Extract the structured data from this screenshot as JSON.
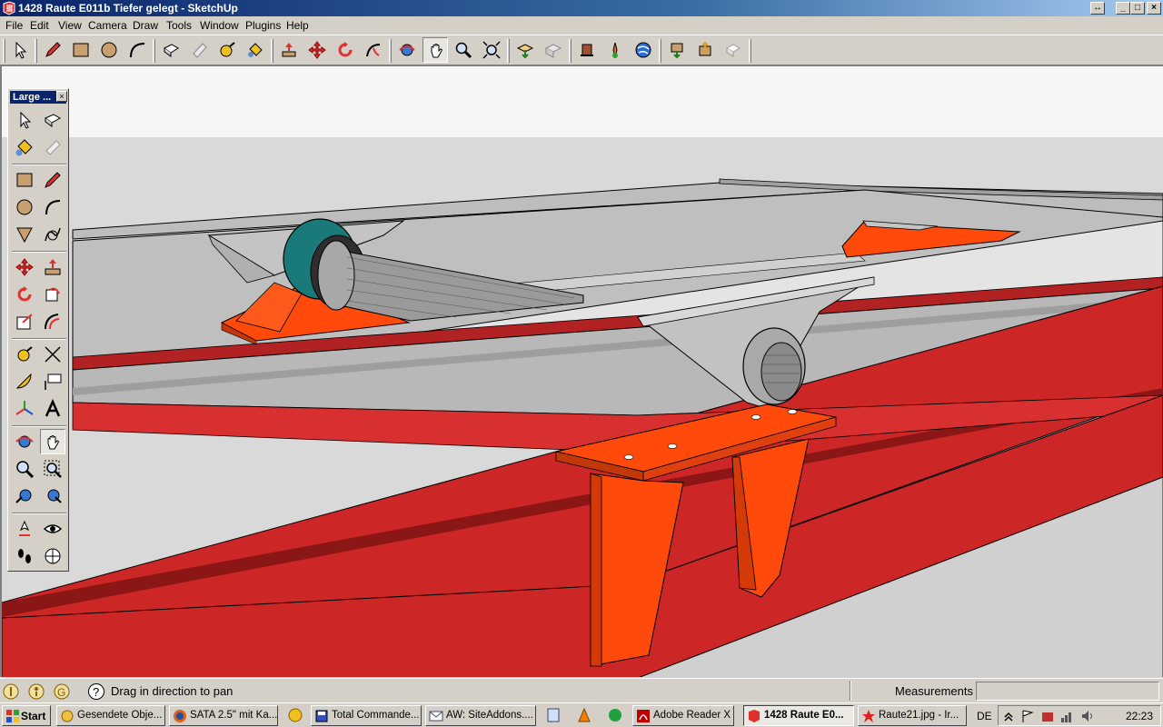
{
  "window": {
    "title": "1428 Raute E011b Tiefer gelegt - SketchUp",
    "controls": {
      "restore_alt": "↔",
      "minimize": "_",
      "maximize": "□",
      "close": "×"
    }
  },
  "menubar": [
    "File",
    "Edit",
    "View",
    "Camera",
    "Draw",
    "Tools",
    "Window",
    "Plugins",
    "Help"
  ],
  "toolbar": {
    "tools": [
      "select-icon",
      "pencil-icon",
      "rectangle-icon",
      "circle-icon",
      "arc-icon",
      "make-component-icon",
      "eraser-icon",
      "tape-measure-icon",
      "paint-bucket-icon",
      "push-pull-icon",
      "move-icon",
      "rotate-icon",
      "follow-me-icon",
      "orbit-icon",
      "pan-icon",
      "zoom-icon",
      "zoom-extents-icon",
      "get-models-icon",
      "share-model-icon",
      "components-icon",
      "add-location-icon",
      "google-earth-icon",
      "get-components-icon",
      "share-component-icon",
      "section-icon"
    ],
    "active": "pan-icon"
  },
  "palette": {
    "title": "Large ...",
    "close": "×",
    "active": "pan-icon"
  },
  "status": {
    "hint": "Drag in direction to pan",
    "measurements_label": "Measurements",
    "measurements_value": ""
  },
  "taskbar": {
    "start": "Start",
    "buttons": [
      {
        "label": "Gesendete Obje...",
        "icon": "outlook-icon"
      },
      {
        "label": "SATA 2.5\" mit Ka...",
        "icon": "firefox-icon"
      },
      {
        "label": "Total Commande...",
        "icon": "total-commander-icon"
      },
      {
        "label": "AW: SiteAddons....",
        "icon": "mail-icon"
      },
      {
        "label": "Adobe Reader X",
        "icon": "adobe-reader-icon"
      },
      {
        "label": "1428 Raute E0...",
        "icon": "sketchup-icon",
        "active": true
      },
      {
        "label": "Raute21.jpg - Ir...",
        "icon": "irfanview-icon"
      }
    ],
    "language": "DE",
    "clock": "22:23"
  },
  "colors": {
    "beam_top": "#c8c8c8",
    "beam_side": "#a8a8a8",
    "red_face": "#cc2626",
    "orange_part": "#ff4a0c",
    "teal_ring": "#1a7a7a",
    "sky": "#f4f4f4",
    "ground": "#d9d9d9"
  }
}
